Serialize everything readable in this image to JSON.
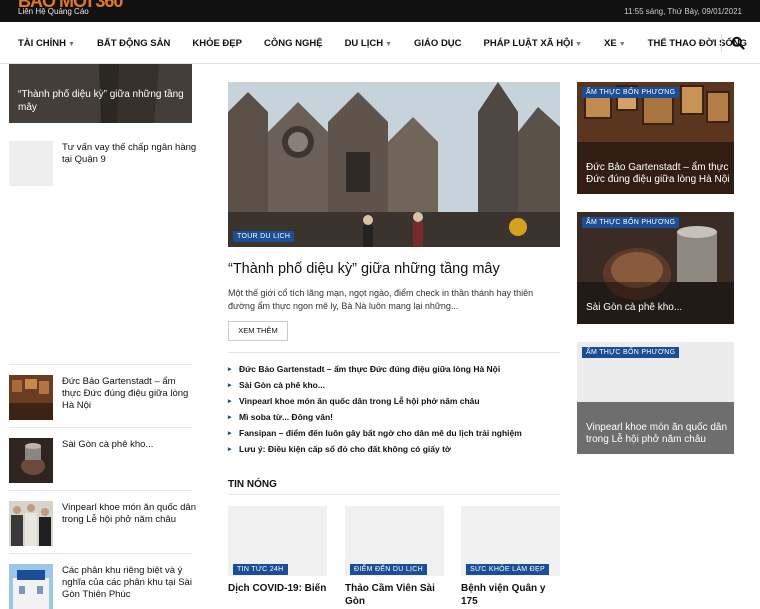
{
  "topbar": {
    "logo": "BÁO MỚI 360",
    "ad_link": "Liên Hệ Quảng Cáo",
    "datetime": "11:55 sáng, Thứ Bảy, 09/01/2021"
  },
  "nav": {
    "items": [
      {
        "label": "TÀI CHÍNH",
        "caret": true
      },
      {
        "label": "BẤT ĐỘNG SẢN",
        "caret": false
      },
      {
        "label": "KHỎE ĐẸP",
        "caret": false
      },
      {
        "label": "CÔNG NGHỆ",
        "caret": false
      },
      {
        "label": "DU LỊCH",
        "caret": true
      },
      {
        "label": "GIÁO DỤC",
        "caret": false
      },
      {
        "label": "PHÁP LUẬT XÃ HỘI",
        "caret": true
      },
      {
        "label": "XE",
        "caret": true
      },
      {
        "label": "THỂ THAO ĐỜI SỐNG",
        "caret": false
      }
    ],
    "search_icon": "search-icon"
  },
  "left": {
    "hero_caption": "“Thành phố diệu kỳ” giữa những tầng mây",
    "rows": [
      {
        "title": "Tư vấn vay thế chấp ngân hàng tại Quận 9"
      },
      {
        "title": "Đức Bảo Gartenstadt – ẩm thực Đức đúng điệu giữa lòng Hà Nội"
      },
      {
        "title": "Sài Gòn cà phê kho..."
      },
      {
        "title": "Vinpearl khoe món ăn quốc dân trong Lễ hội phở năm châu"
      },
      {
        "title": "Các phân khu riêng biệt và ý nghĩa của các phân khu tại Sài Gòn Thiên Phúc"
      }
    ]
  },
  "main": {
    "tag": "TOUR DU LỊCH",
    "headline": "“Thành phố diệu kỳ” giữa những tầng mây",
    "excerpt": "Một thế giới cổ tích lãng mạn, ngọt ngào, điểm check in thần thánh hay thiên đường ẩm thực ngon mê ly, Bà Nà luôn mang lại những...",
    "more_button": "XEM THÊM",
    "links": [
      "Đức Bảo Gartenstadt – ẩm thực Đức đúng điệu giữa lòng Hà Nội",
      "Sài Gòn cà phê kho...",
      "Vinpearl khoe món ăn quốc dân trong Lễ hội phở năm châu",
      "Mì soba từ... Đông vân!",
      "Fansipan – điểm đến luôn gây bất ngờ cho dân mê du lịch trải nghiệm",
      "Lưu ý: Điều kiện cấp sổ đỏ cho đất không có giấy tờ"
    ],
    "hot_heading": "TIN NÓNG",
    "hot_cards": [
      {
        "tag": "TIN TỨC 24H",
        "title": "Dịch COVID-19: Biến"
      },
      {
        "tag": "ĐIỂM ĐẾN DU LỊCH",
        "title": "Thảo Cầm Viên Sài Gòn"
      },
      {
        "tag": "SỨC KHỎE LÀM ĐẸP",
        "title": "Bệnh viện Quân y 175"
      }
    ]
  },
  "right": {
    "cards": [
      {
        "tag": "ẨM THỰC BỐN PHƯƠNG",
        "title": "Đức Bảo Gartenstadt – ẩm thực Đức đúng điệu giữa lòng Hà Nội"
      },
      {
        "tag": "ẨM THỰC BỐN PHƯƠNG",
        "title": "Sài Gòn cà phê kho..."
      },
      {
        "tag": "ẨM THỰC BỐN PHƯƠNG",
        "title": "Vinpearl khoe món ăn quốc dân trong Lễ hội phở năm châu"
      }
    ]
  },
  "colors": {
    "tag_bg": "#1a4e96",
    "topbar_bg": "#111111",
    "logo": "#e0782a"
  }
}
